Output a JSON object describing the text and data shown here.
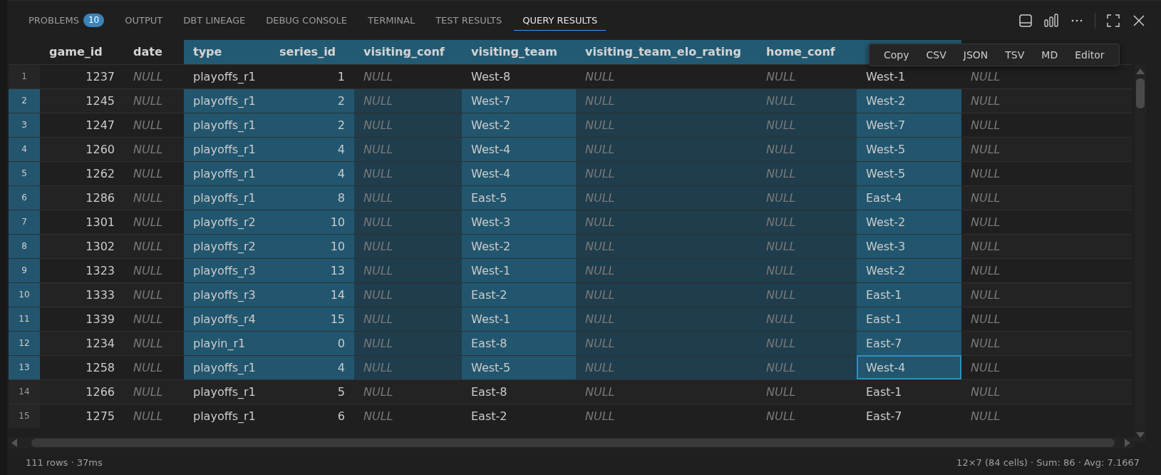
{
  "tabs": [
    {
      "label": "PROBLEMS",
      "badge": "10",
      "selected": false
    },
    {
      "label": "OUTPUT",
      "selected": false
    },
    {
      "label": "DBT LINEAGE",
      "selected": false
    },
    {
      "label": "DEBUG CONSOLE",
      "selected": false
    },
    {
      "label": "TERMINAL",
      "selected": false
    },
    {
      "label": "TEST RESULTS",
      "selected": false
    },
    {
      "label": "QUERY RESULTS",
      "selected": true
    }
  ],
  "table": {
    "columns": [
      {
        "label": "game_id",
        "kind": "number",
        "selected": false
      },
      {
        "label": "date",
        "kind": "null",
        "selected": false
      },
      {
        "label": "type",
        "kind": "text",
        "selected": true
      },
      {
        "label": "series_id",
        "kind": "number",
        "selected": true
      },
      {
        "label": "visiting_conf",
        "kind": "null",
        "selected": true
      },
      {
        "label": "visiting_team",
        "kind": "text",
        "selected": true
      },
      {
        "label": "visiting_team_elo_rating",
        "kind": "null",
        "selected": true
      },
      {
        "label": "home_conf",
        "kind": "null",
        "selected": true
      },
      {
        "kind": "text",
        "selected": true,
        "focus": true
      },
      {
        "kind": "null",
        "selected": false
      }
    ],
    "rows": [
      {
        "number": "1",
        "selected": false,
        "cells": [
          "1237",
          "NULL",
          "playoffs_r1",
          "1",
          "NULL",
          "West-8",
          "NULL",
          "NULL",
          "West-1",
          "NULL"
        ]
      },
      {
        "number": "2",
        "selected": true,
        "cells": [
          "1245",
          "NULL",
          "playoffs_r1",
          "2",
          "NULL",
          "West-7",
          "NULL",
          "NULL",
          "West-2",
          "NULL"
        ]
      },
      {
        "number": "3",
        "selected": true,
        "cells": [
          "1247",
          "NULL",
          "playoffs_r1",
          "2",
          "NULL",
          "West-2",
          "NULL",
          "NULL",
          "West-7",
          "NULL"
        ]
      },
      {
        "number": "4",
        "selected": true,
        "cells": [
          "1260",
          "NULL",
          "playoffs_r1",
          "4",
          "NULL",
          "West-4",
          "NULL",
          "NULL",
          "West-5",
          "NULL"
        ]
      },
      {
        "number": "5",
        "selected": true,
        "cells": [
          "1262",
          "NULL",
          "playoffs_r1",
          "4",
          "NULL",
          "West-4",
          "NULL",
          "NULL",
          "West-5",
          "NULL"
        ]
      },
      {
        "number": "6",
        "selected": true,
        "cells": [
          "1286",
          "NULL",
          "playoffs_r1",
          "8",
          "NULL",
          "East-5",
          "NULL",
          "NULL",
          "East-4",
          "NULL"
        ]
      },
      {
        "number": "7",
        "selected": true,
        "cells": [
          "1301",
          "NULL",
          "playoffs_r2",
          "10",
          "NULL",
          "West-3",
          "NULL",
          "NULL",
          "West-2",
          "NULL"
        ]
      },
      {
        "number": "8",
        "selected": true,
        "cells": [
          "1302",
          "NULL",
          "playoffs_r2",
          "10",
          "NULL",
          "West-2",
          "NULL",
          "NULL",
          "West-3",
          "NULL"
        ]
      },
      {
        "number": "9",
        "selected": true,
        "cells": [
          "1323",
          "NULL",
          "playoffs_r3",
          "13",
          "NULL",
          "West-1",
          "NULL",
          "NULL",
          "West-2",
          "NULL"
        ]
      },
      {
        "number": "10",
        "selected": true,
        "cells": [
          "1333",
          "NULL",
          "playoffs_r3",
          "14",
          "NULL",
          "East-2",
          "NULL",
          "NULL",
          "East-1",
          "NULL"
        ]
      },
      {
        "number": "11",
        "selected": true,
        "cells": [
          "1339",
          "NULL",
          "playoffs_r4",
          "15",
          "NULL",
          "West-1",
          "NULL",
          "NULL",
          "East-1",
          "NULL"
        ]
      },
      {
        "number": "12",
        "selected": true,
        "cells": [
          "1234",
          "NULL",
          "playin_r1",
          "0",
          "NULL",
          "East-8",
          "NULL",
          "NULL",
          "East-7",
          "NULL"
        ]
      },
      {
        "number": "13",
        "selected": true,
        "focus": true,
        "cells": [
          "1258",
          "NULL",
          "playoffs_r1",
          "4",
          "NULL",
          "West-5",
          "NULL",
          "NULL",
          "West-4",
          "NULL"
        ]
      },
      {
        "number": "14",
        "selected": false,
        "cells": [
          "1266",
          "NULL",
          "playoffs_r1",
          "5",
          "NULL",
          "East-8",
          "NULL",
          "NULL",
          "East-1",
          "NULL"
        ]
      },
      {
        "number": "15",
        "selected": false,
        "cells": [
          "1275",
          "NULL",
          "playoffs_r1",
          "6",
          "NULL",
          "East-2",
          "NULL",
          "NULL",
          "East-7",
          "NULL"
        ]
      }
    ]
  },
  "copy_menu": [
    "Copy",
    "CSV",
    "JSON",
    "TSV",
    "MD",
    "Editor"
  ],
  "status_bar": {
    "left": "111 rows · 37ms",
    "right": "12×7 (84 cells) · Sum: 86 · Avg: 7.1667"
  }
}
